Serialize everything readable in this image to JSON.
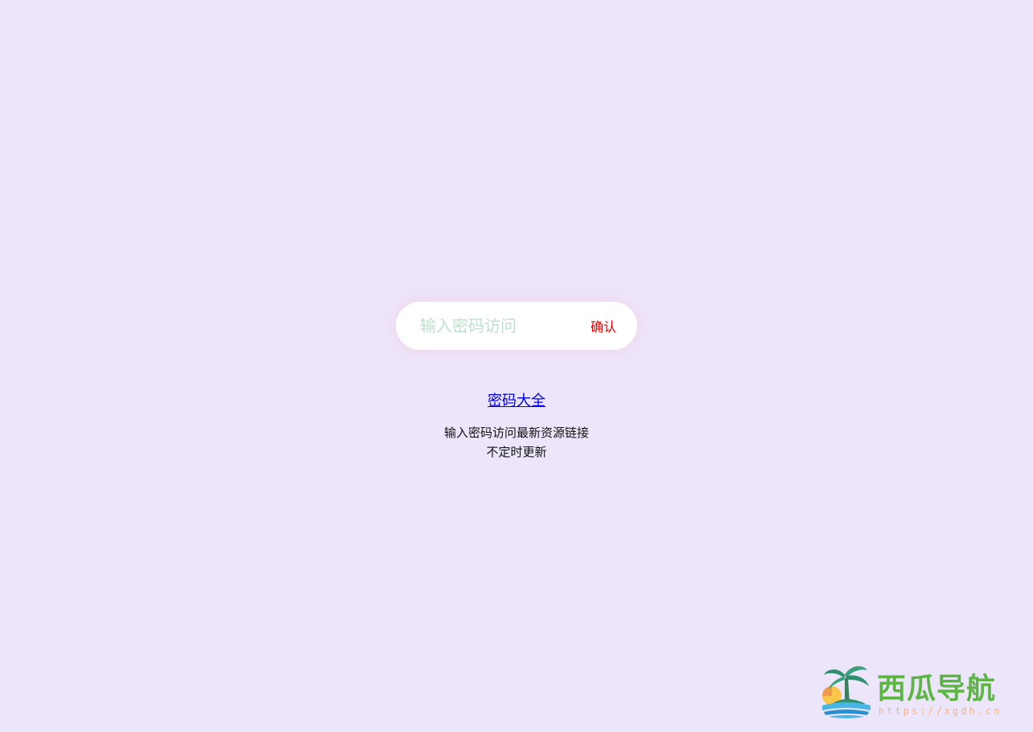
{
  "password_form": {
    "placeholder": "输入密码访问",
    "confirm_label": "确认"
  },
  "links": {
    "password_list_label": "密码大全"
  },
  "description": {
    "line1": "输入密码访问最新资源链接",
    "line2": "不定时更新"
  },
  "brand": {
    "name": "西瓜导航",
    "url": "https://xgdh.cn"
  },
  "colors": {
    "background": "#ede6fb",
    "confirm": "#e00000",
    "link": "#0000ee",
    "brand_green": "#5db546",
    "brand_url": "#f6b27e"
  }
}
